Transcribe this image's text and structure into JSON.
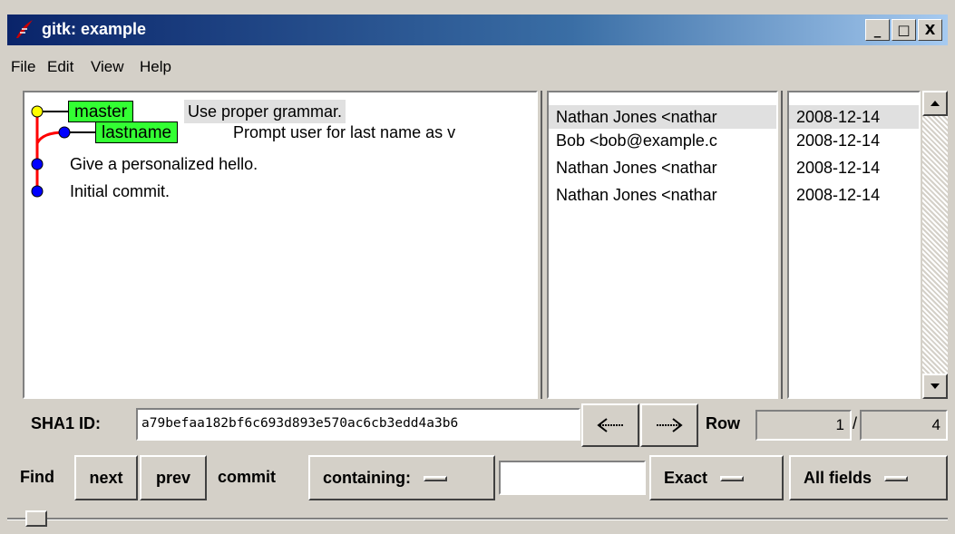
{
  "window": {
    "title": "gitk: example",
    "min": "_",
    "max": "□",
    "close": "X"
  },
  "menu": [
    "File",
    "Edit",
    "View",
    "Help"
  ],
  "commits": [
    {
      "tag": "master",
      "subject": "Use proper grammar.",
      "author": "Nathan Jones <nathar",
      "date": "2008-12-14",
      "selected": true
    },
    {
      "tag": "lastname",
      "subject": "Prompt user for last name as v",
      "author": "Bob <bob@example.c",
      "date": "2008-12-14",
      "selected": false
    },
    {
      "tag": "",
      "subject": "Give a personalized hello.",
      "author": "Nathan Jones <nathar",
      "date": "2008-12-14",
      "selected": false
    },
    {
      "tag": "",
      "subject": "Initial commit.",
      "author": "Nathan Jones <nathar",
      "date": "2008-12-14",
      "selected": false
    }
  ],
  "sha": {
    "label": "SHA1 ID:",
    "value": "a79befaa182bf6c693d893e570ac6cb3edd4a3b6"
  },
  "nav": {
    "back_icon": "left-arrow-icon",
    "forward_icon": "right-arrow-icon"
  },
  "row": {
    "label": "Row",
    "current": "1",
    "sep": "/",
    "total": "4"
  },
  "find": {
    "label": "Find",
    "next": "next",
    "prev": "prev",
    "type": "commit",
    "containing": "containing:",
    "query": "",
    "exact": "Exact",
    "fields": "All fields"
  },
  "colors": {
    "tag_green": "#33ff33",
    "head_node": "#ffff00",
    "node": "#0000ff",
    "branch_line": "#ff0000"
  }
}
